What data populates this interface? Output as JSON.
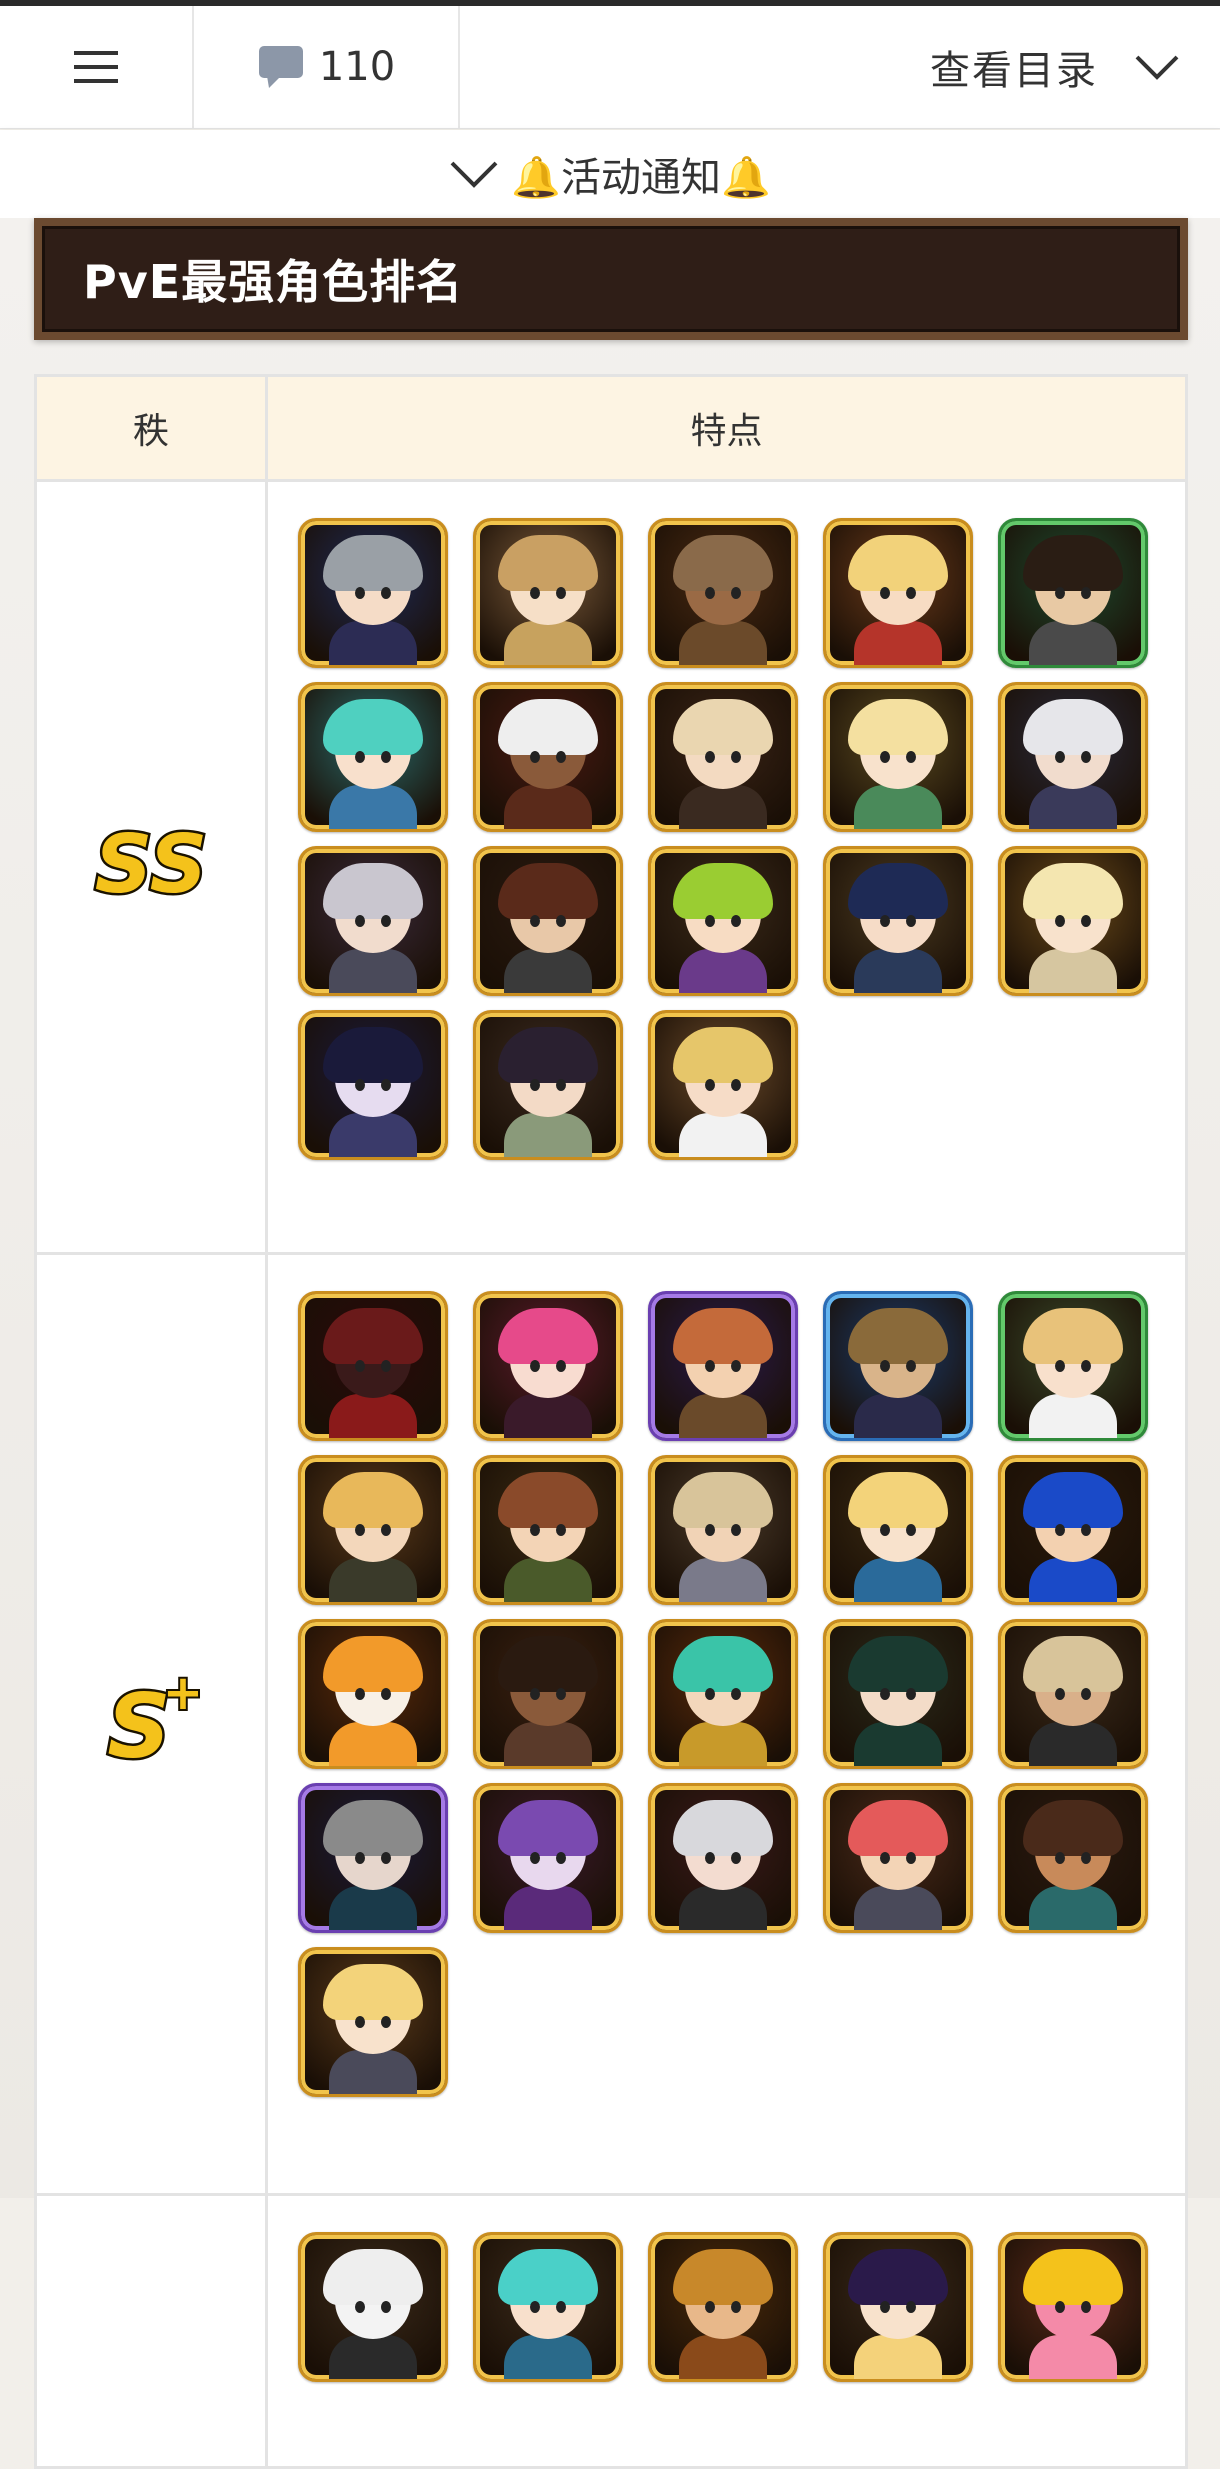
{
  "nav": {
    "menu_icon": "hamburger-menu-icon",
    "comment_icon": "comment-bubble-icon",
    "comment_count": "110",
    "toc_label": "查看目录",
    "toc_icon": "chevron-down-icon"
  },
  "notice": {
    "label": "🔔活动通知🔔",
    "toggle_icon": "chevron-down-icon"
  },
  "section": {
    "title": "PvE最强角色排名"
  },
  "table": {
    "headers": [
      "秩",
      "特点"
    ],
    "rows": [
      {
        "tier_badge": "SS",
        "tier_color": "#f4c21b",
        "heroes": [
          {
            "frame": "gold",
            "hair": "#9aa0a6",
            "skin": "#f5dcc7",
            "bg": "#1e2a55",
            "outfit": "#2c2c54"
          },
          {
            "frame": "gold",
            "hair": "#c9a063",
            "skin": "#f6dfc7",
            "bg": "#7a5a3a",
            "outfit": "#c7a25e"
          },
          {
            "frame": "gold",
            "hair": "#8a6a4a",
            "skin": "#9a6a45",
            "bg": "#4a2a12",
            "outfit": "#6b4a2a"
          },
          {
            "frame": "gold",
            "hair": "#f2d27a",
            "skin": "#f7dcc3",
            "bg": "#6a3a1a",
            "outfit": "#b5342a"
          },
          {
            "frame": "green",
            "hair": "#2a1d14",
            "skin": "#e8c9a4",
            "bg": "#1e4a2e",
            "outfit": "#4a4a4a"
          },
          {
            "frame": "gold",
            "hair": "#4fd0c0",
            "skin": "#f8e0cc",
            "bg": "#2a6a6a",
            "outfit": "#3a78a8"
          },
          {
            "frame": "gold",
            "hair": "#eeeeee",
            "skin": "#8a5a3a",
            "bg": "#4a1a12",
            "outfit": "#5a2a1a"
          },
          {
            "frame": "gold",
            "hair": "#ead6b0",
            "skin": "#f3dac1",
            "bg": "#3a2416",
            "outfit": "#3a2a20"
          },
          {
            "frame": "gold",
            "hair": "#f4e0a0",
            "skin": "#f8e2cc",
            "bg": "#5a4a20",
            "outfit": "#4a8a5a"
          },
          {
            "frame": "gold",
            "hair": "#e6e6ea",
            "skin": "#f1dccd",
            "bg": "#2a2a3a",
            "outfit": "#3a3a5a"
          },
          {
            "frame": "gold",
            "hair": "#c9c6cf",
            "skin": "#f1dccd",
            "bg": "#3a2a3a",
            "outfit": "#4a4a5a"
          },
          {
            "frame": "gold",
            "hair": "#5a2a1a",
            "skin": "#e8c8a8",
            "bg": "#2a1a10",
            "outfit": "#3a3a3a"
          },
          {
            "frame": "gold",
            "hair": "#9acd32",
            "skin": "#f7dcc3",
            "bg": "#3a2a1a",
            "outfit": "#6a3a8a"
          },
          {
            "frame": "gold",
            "hair": "#1e2a55",
            "skin": "#f6dcc7",
            "bg": "#4a3a20",
            "outfit": "#2a3a5a"
          },
          {
            "frame": "gold",
            "hair": "#f4e6b0",
            "skin": "#f8e2cc",
            "bg": "#6a4a1a",
            "outfit": "#d6c6a0"
          },
          {
            "frame": "gold",
            "hair": "#1a1a3a",
            "skin": "#e6dcf0",
            "bg": "#1a1a3a",
            "outfit": "#3a3a6a"
          },
          {
            "frame": "gold",
            "hair": "#2a2030",
            "skin": "#f3dac6",
            "bg": "#3a2a20",
            "outfit": "#8a9a7a"
          },
          {
            "frame": "gold",
            "hair": "#e6c66a",
            "skin": "#f6dcc7",
            "bg": "#6a4a2a",
            "outfit": "#f2f2f2"
          }
        ]
      },
      {
        "tier_badge": "S+",
        "tier_color": "#f4c21b",
        "heroes": [
          {
            "frame": "gold",
            "hair": "#6a1a1a",
            "skin": "#3a1a1a",
            "bg": "#2a0a0a",
            "outfit": "#8a1a1a"
          },
          {
            "frame": "gold",
            "hair": "#e64a8a",
            "skin": "#f8dcd0",
            "bg": "#5a1a2a",
            "outfit": "#3a1a2a"
          },
          {
            "frame": "purple",
            "hair": "#c46a3a",
            "skin": "#f3d1b0",
            "bg": "#2a1a4a",
            "outfit": "#6a4a2a"
          },
          {
            "frame": "blue",
            "hair": "#8a6a3a",
            "skin": "#d9b48a",
            "bg": "#1a3a6a",
            "outfit": "#2a2a4a"
          },
          {
            "frame": "green",
            "hair": "#e8c27a",
            "skin": "#f8e0cc",
            "bg": "#3a4a2a",
            "outfit": "#f2f2f2"
          },
          {
            "frame": "gold",
            "hair": "#e8b85a",
            "skin": "#f3d7bb",
            "bg": "#5a3a1a",
            "outfit": "#3a3a2a"
          },
          {
            "frame": "gold",
            "hair": "#8a4a2a",
            "skin": "#f3d4b6",
            "bg": "#3a2a12",
            "outfit": "#4a5a2a"
          },
          {
            "frame": "gold",
            "hair": "#d8c49a",
            "skin": "#f1d3b6",
            "bg": "#4a3a2a",
            "outfit": "#7a7a8a"
          },
          {
            "frame": "gold",
            "hair": "#f3d37a",
            "skin": "#f8e2cc",
            "bg": "#3a2a12",
            "outfit": "#2a6a9a"
          },
          {
            "frame": "gold",
            "hair": "#1a4ac8",
            "skin": "#f3d1b0",
            "bg": "#2a1a0a",
            "outfit": "#1a4ac8"
          },
          {
            "frame": "gold",
            "hair": "#f29a2a",
            "skin": "#f8f0e6",
            "bg": "#5a2a0a",
            "outfit": "#f29a2a"
          },
          {
            "frame": "gold",
            "hair": "#2a1a10",
            "skin": "#8a5a3a",
            "bg": "#3a2010",
            "outfit": "#5a3a2a"
          },
          {
            "frame": "gold",
            "hair": "#3ac4a8",
            "skin": "#f3d7bb",
            "bg": "#5a2a0a",
            "outfit": "#c89a2a"
          },
          {
            "frame": "gold",
            "hair": "#1a3a30",
            "skin": "#f3dcc8",
            "bg": "#2a2a1a",
            "outfit": "#1a3a30"
          },
          {
            "frame": "gold",
            "hair": "#d8c49a",
            "skin": "#d9b08a",
            "bg": "#3a2a1a",
            "outfit": "#2a2a2a"
          },
          {
            "frame": "purple",
            "hair": "#8a8a8a",
            "skin": "#e6d6cc",
            "bg": "#1a1a3a",
            "outfit": "#1a3a4a"
          },
          {
            "frame": "gold",
            "hair": "#7a4ab0",
            "skin": "#e8d8ee",
            "bg": "#3a1a2a",
            "outfit": "#5a2a7a"
          },
          {
            "frame": "gold",
            "hair": "#d8d8dc",
            "skin": "#f3dcd0",
            "bg": "#3a1a1a",
            "outfit": "#2a2a2a"
          },
          {
            "frame": "gold",
            "hair": "#e45a5a",
            "skin": "#f3d4b6",
            "bg": "#4a2a1a",
            "outfit": "#4a4a5a"
          },
          {
            "frame": "gold",
            "hair": "#4a2a1a",
            "skin": "#c88a5a",
            "bg": "#2a1a10",
            "outfit": "#2a6a6a"
          },
          {
            "frame": "gold",
            "hair": "#f3d37a",
            "skin": "#f8e2cc",
            "bg": "#5a3a1a",
            "outfit": "#4a4a5a"
          }
        ]
      },
      {
        "tier_badge": "",
        "tier_color": "#f4c21b",
        "heroes": [
          {
            "frame": "gold",
            "hair": "#eeeeee",
            "skin": "#f3f3f3",
            "bg": "#3a2a1a",
            "outfit": "#2a2a2a"
          },
          {
            "frame": "gold",
            "hair": "#4ad0c8",
            "skin": "#f8e0cc",
            "bg": "#3a2a1a",
            "outfit": "#2a6a8a"
          },
          {
            "frame": "gold",
            "hair": "#c8882a",
            "skin": "#e8b88a",
            "bg": "#4a2a0a",
            "outfit": "#8a4a1a"
          },
          {
            "frame": "gold",
            "hair": "#2a1a4a",
            "skin": "#f8e2cc",
            "bg": "#3a2a1a",
            "outfit": "#f4d27a"
          },
          {
            "frame": "gold",
            "hair": "#f4c21b",
            "skin": "#f48aa8",
            "bg": "#5a2a1a",
            "outfit": "#f48aa8"
          }
        ]
      }
    ]
  }
}
